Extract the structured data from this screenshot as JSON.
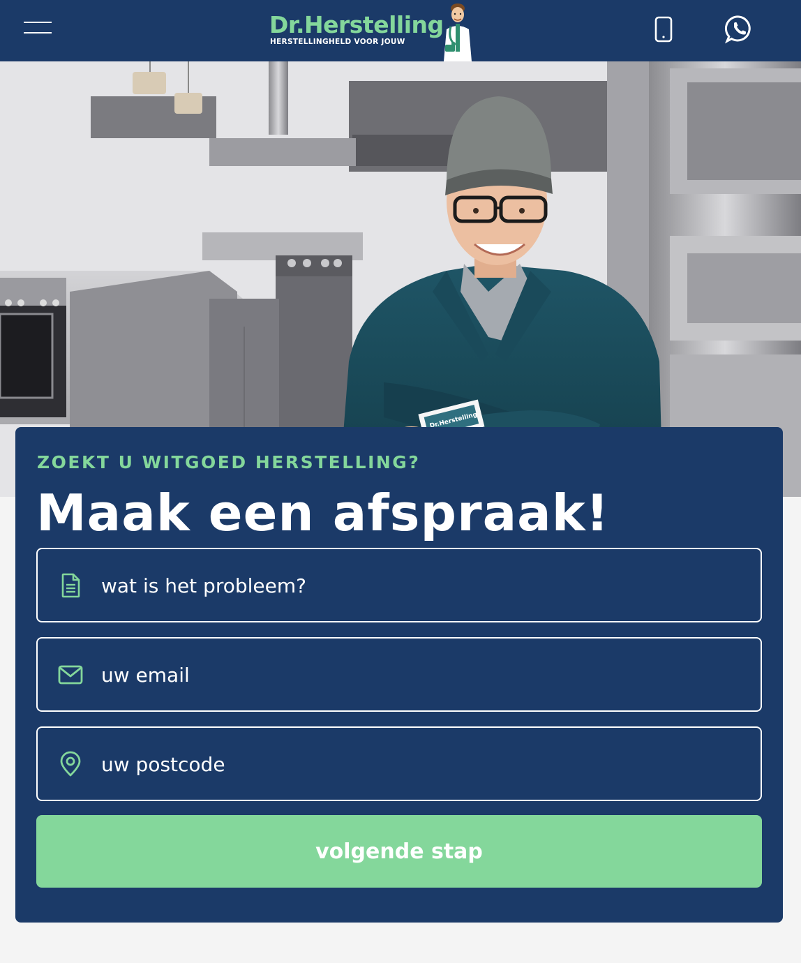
{
  "header": {
    "logo_name": "Dr.Herstelling",
    "logo_tagline": "HERSTELLINGHELD VOOR JOUW",
    "menu_icon": "hamburger-menu-icon",
    "phone_icon": "mobile-phone-icon",
    "whatsapp_icon": "whatsapp-icon"
  },
  "hero": {
    "badge_text": "Dr.Herstelling"
  },
  "form": {
    "eyebrow": "ZOEKT U WITGOED HERSTELLING?",
    "title": "Maak een afspraak!",
    "problem_placeholder": "wat is het probleem?",
    "email_placeholder": "uw email",
    "postcode_placeholder": "uw postcode",
    "submit_label": "volgende stap"
  },
  "colors": {
    "navy": "#1b3a68",
    "accent_green": "#84d79b",
    "white": "#ffffff",
    "page_bg": "#f4f4f4"
  }
}
